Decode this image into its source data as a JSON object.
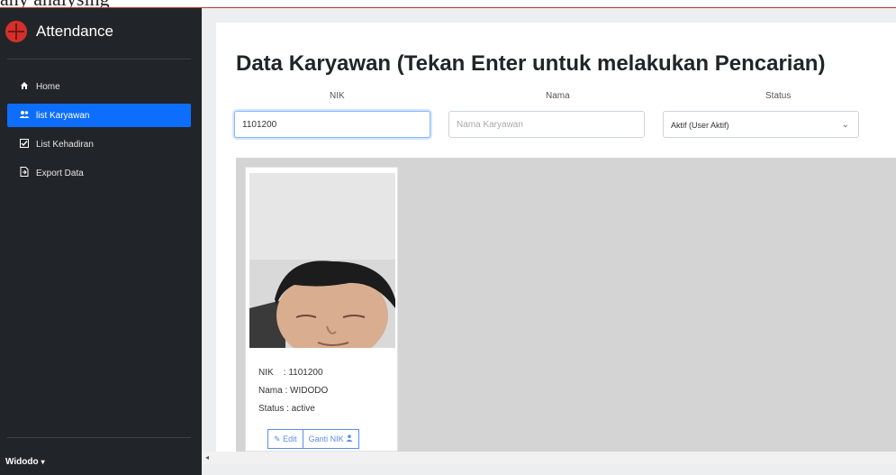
{
  "caption": "any analysing",
  "app": {
    "title": "Attendance",
    "logo_icon": "medical-cross-icon",
    "brand_color": "#d3302b"
  },
  "sidebar": {
    "items": [
      {
        "label": "Home",
        "icon": "home-icon",
        "active": false
      },
      {
        "label": "list Karyawan",
        "icon": "users-icon",
        "active": true
      },
      {
        "label": "List Kehadiran",
        "icon": "checklist-icon",
        "active": false
      },
      {
        "label": "Export Data",
        "icon": "file-export-icon",
        "active": false
      }
    ],
    "active_color": "#0d6efd",
    "user": "Widodo"
  },
  "main": {
    "title": "Data Karyawan (Tekan Enter untuk melakukan Pencarian)",
    "filters": {
      "nik_label": "NIK",
      "nik_value": "1101200",
      "nama_label": "Nama",
      "nama_placeholder": "Nama Karyawan",
      "status_label": "Status",
      "status_value": "Aktif (User Aktif)"
    },
    "employees": [
      {
        "nik_line": "NIK    : 1101200",
        "nama_line": "Nama : WIDODO",
        "status_line": "Status : active",
        "edit_label": "Edit",
        "ganti_label": "Ganti NIK"
      }
    ]
  }
}
